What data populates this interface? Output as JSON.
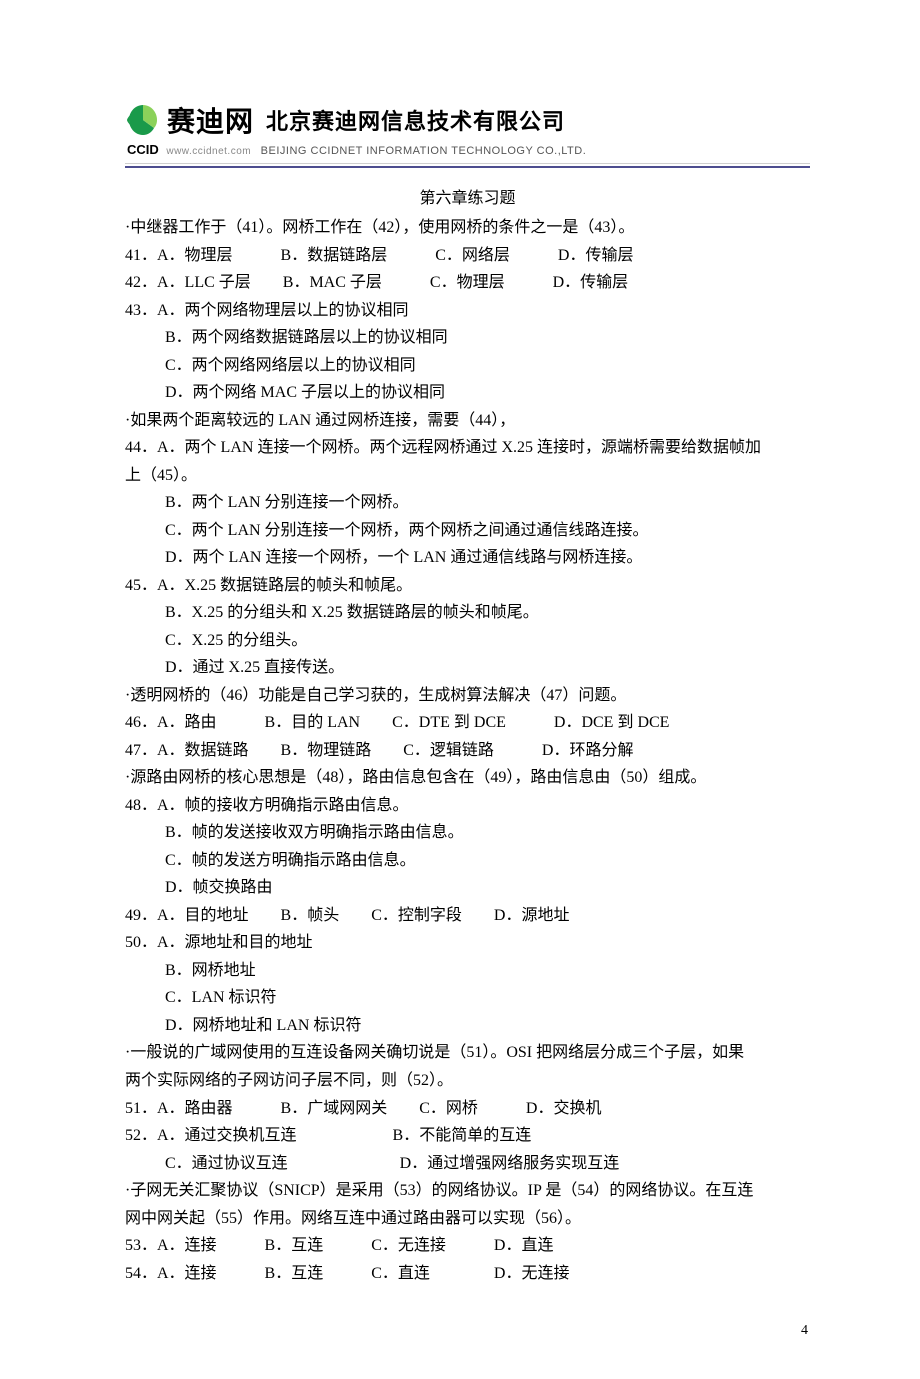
{
  "header": {
    "logo_cn": "赛迪网",
    "company_cn": "北京赛迪网信息技术有限公司",
    "ccid": "CCID",
    "domain": "www.ccidnet.com",
    "company_en": "BEIJING CCIDNET INFORMATION TECHNOLOGY CO.,LTD."
  },
  "title": "第六章练习题",
  "lines": [
    {
      "t": "·中继器工作于（41）。网桥工作在（42），使用网桥的条件之一是（43）。"
    },
    {
      "t": "41．A．物理层　　　B．数据链路层　　　C．网络层　　　D．传输层"
    },
    {
      "t": "42．A．LLC 子层　　B．MAC 子层　　　C．物理层　　　D．传输层"
    },
    {
      "t": "43．A．两个网络物理层以上的协议相同"
    },
    {
      "t": "B．两个网络数据链路层以上的协议相同",
      "i": true
    },
    {
      "t": "C．两个网络网络层以上的协议相同",
      "i": true
    },
    {
      "t": "D．两个网络 MAC 子层以上的协议相同",
      "i": true
    },
    {
      "t": "·如果两个距离较远的 LAN 通过网桥连接，需要（44），"
    },
    {
      "t": "44．A．两个 LAN 连接一个网桥。两个远程网桥通过 X.25 连接时，源端桥需要给数据帧加"
    },
    {
      "t": "上（45）。"
    },
    {
      "t": "B．两个 LAN 分别连接一个网桥。",
      "i": true
    },
    {
      "t": "C．两个 LAN 分别连接一个网桥，两个网桥之间通过通信线路连接。",
      "i": true
    },
    {
      "t": "D．两个 LAN 连接一个网桥，一个 LAN 通过通信线路与网桥连接。",
      "i": true
    },
    {
      "t": "45．A．X.25 数据链路层的帧头和帧尾。"
    },
    {
      "t": "B．X.25 的分组头和 X.25 数据链路层的帧头和帧尾。",
      "i": true
    },
    {
      "t": "C．X.25 的分组头。",
      "i": true
    },
    {
      "t": "D．通过 X.25 直接传送。",
      "i": true
    },
    {
      "t": "·透明网桥的（46）功能是自己学习获的，生成树算法解决（47）问题。"
    },
    {
      "t": "46．A．路由　　　B．目的 LAN　　C．DTE 到 DCE　　　D．DCE 到 DCE"
    },
    {
      "t": "47．A．数据链路　　B．物理链路　　C．逻辑链路　　　D．环路分解"
    },
    {
      "t": "·源路由网桥的核心思想是（48），路由信息包含在（49），路由信息由（50）组成。"
    },
    {
      "t": "48．A．帧的接收方明确指示路由信息。"
    },
    {
      "t": "B．帧的发送接收双方明确指示路由信息。",
      "i": true
    },
    {
      "t": "C．帧的发送方明确指示路由信息。",
      "i": true
    },
    {
      "t": "D．帧交换路由",
      "i": true
    },
    {
      "t": "49．A．目的地址　　B．帧头　　C．控制字段　　D．源地址"
    },
    {
      "t": "50．A．源地址和目的地址"
    },
    {
      "t": "B．网桥地址",
      "i": true
    },
    {
      "t": "C．LAN 标识符",
      "i": true
    },
    {
      "t": "D．网桥地址和 LAN 标识符",
      "i": true
    },
    {
      "t": "·一般说的广域网使用的互连设备网关确切说是（51）。OSI 把网络层分成三个子层，如果"
    },
    {
      "t": "两个实际网络的子网访问子层不同，则（52）。"
    },
    {
      "t": "51．A．路由器　　　B．广域网网关　　C．网桥　　　D．交换机"
    },
    {
      "t": "52．A．通过交换机互连　　　　　　B．不能简单的互连"
    },
    {
      "t": "C．通过协议互连　　　　　　　D．通过增强网络服务实现互连",
      "i": true
    },
    {
      "t": "·子网无关汇聚协议（SNICP）是采用（53）的网络协议。IP 是（54）的网络协议。在互连"
    },
    {
      "t": "网中网关起（55）作用。网络互连中通过路由器可以实现（56）。"
    },
    {
      "t": "53．A．连接　　　B．互连　　　C．无连接　　　D．直连"
    },
    {
      "t": "54．A．连接　　　B．互连　　　C．直连　　　　D．无连接"
    }
  ],
  "page_number": "4"
}
